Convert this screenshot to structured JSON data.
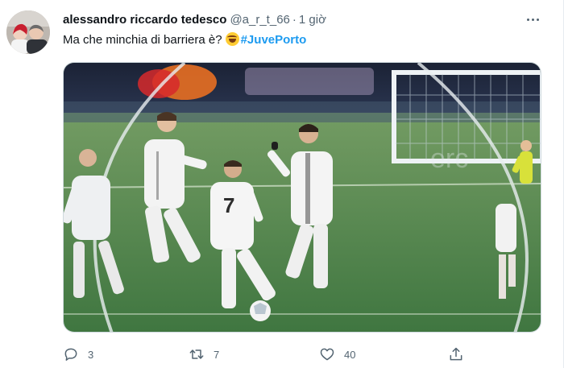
{
  "tweet": {
    "author_name": "alessandro riccardo tedesco",
    "author_handle": "@a_r_t_66",
    "separator": "·",
    "time": "1 giờ",
    "text": "Ma che minchia di barriera è?",
    "emoji": "rolling-on-floor-laughing-emoji",
    "hashtag": "#JuvePorto",
    "hashtag_color": "#1d9bf0",
    "media_description_icon": "football-free-kick-wall-photo",
    "stats": {
      "replies": "3",
      "retweets": "7",
      "likes": "40"
    }
  },
  "icons": {
    "more": "more-options-icon",
    "reply": "reply-icon",
    "retweet": "retweet-icon",
    "like": "heart-icon",
    "share": "share-icon"
  }
}
